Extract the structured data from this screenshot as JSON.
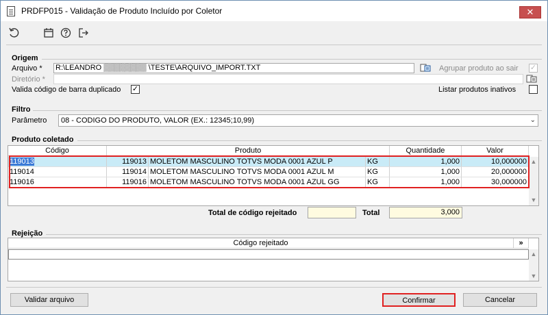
{
  "window": {
    "title": "PRDFP015 - Validação de Produto Incluído por Coletor",
    "close_label": "✕"
  },
  "toolbar": {
    "icons": [
      "undo-icon",
      "calendar-icon",
      "help-icon",
      "exit-icon"
    ]
  },
  "origem": {
    "label": "Origem",
    "arquivo_label": "Arquivo *",
    "arquivo_value": "R:\\LEANDRO ▒▒▒▒▒▒▒▒ \\TESTE\\ARQUIVO_IMPORT.TXT",
    "diretorio_label": "Diretório *",
    "diretorio_value": "",
    "agrupar_label": "Agrupar produto ao sair",
    "agrupar_checked": "✓",
    "valida_label": "Valida código de barra duplicado",
    "valida_checked": "✓",
    "listar_label": "Listar produtos inativos",
    "listar_checked": ""
  },
  "filtro": {
    "label": "Filtro",
    "parametro_label": "Parâmetro",
    "parametro_value": "08 - CODIGO DO PRODUTO, VALOR (EX.: 12345;10,99)"
  },
  "produto": {
    "label": "Produto coletado",
    "columns": [
      "Código",
      "Produto",
      "Quantidade",
      "Valor"
    ],
    "rows": [
      {
        "codigo": "119013",
        "produto_cod": "119013",
        "produto_nome": "MOLETOM MASCULINO TOTVS MODA 0001 AZUL P",
        "unidade": "KG",
        "quantidade": "1,000",
        "valor": "10,000000"
      },
      {
        "codigo": "119014",
        "produto_cod": "119014",
        "produto_nome": "MOLETOM MASCULINO TOTVS MODA 0001 AZUL M",
        "unidade": "KG",
        "quantidade": "1,000",
        "valor": "20,000000"
      },
      {
        "codigo": "119016",
        "produto_cod": "119016",
        "produto_nome": "MOLETOM MASCULINO TOTVS MODA 0001 AZUL GG",
        "unidade": "KG",
        "quantidade": "1,000",
        "valor": "30,000000"
      }
    ],
    "total_rejeitado_label": "Total de código rejeitado",
    "total_rejeitado_value": "",
    "total_label": "Total",
    "total_value": "3,000"
  },
  "rejeicao": {
    "label": "Rejeição",
    "column": "Código rejeitado",
    "expand_label": "»"
  },
  "buttons": {
    "validar": "Validar arquivo",
    "confirmar": "Confirmar",
    "cancelar": "Cancelar"
  },
  "colors": {
    "selected_row": "#b8e4f5",
    "highlight": "#e02020",
    "total_bg": "#fffbe0"
  }
}
